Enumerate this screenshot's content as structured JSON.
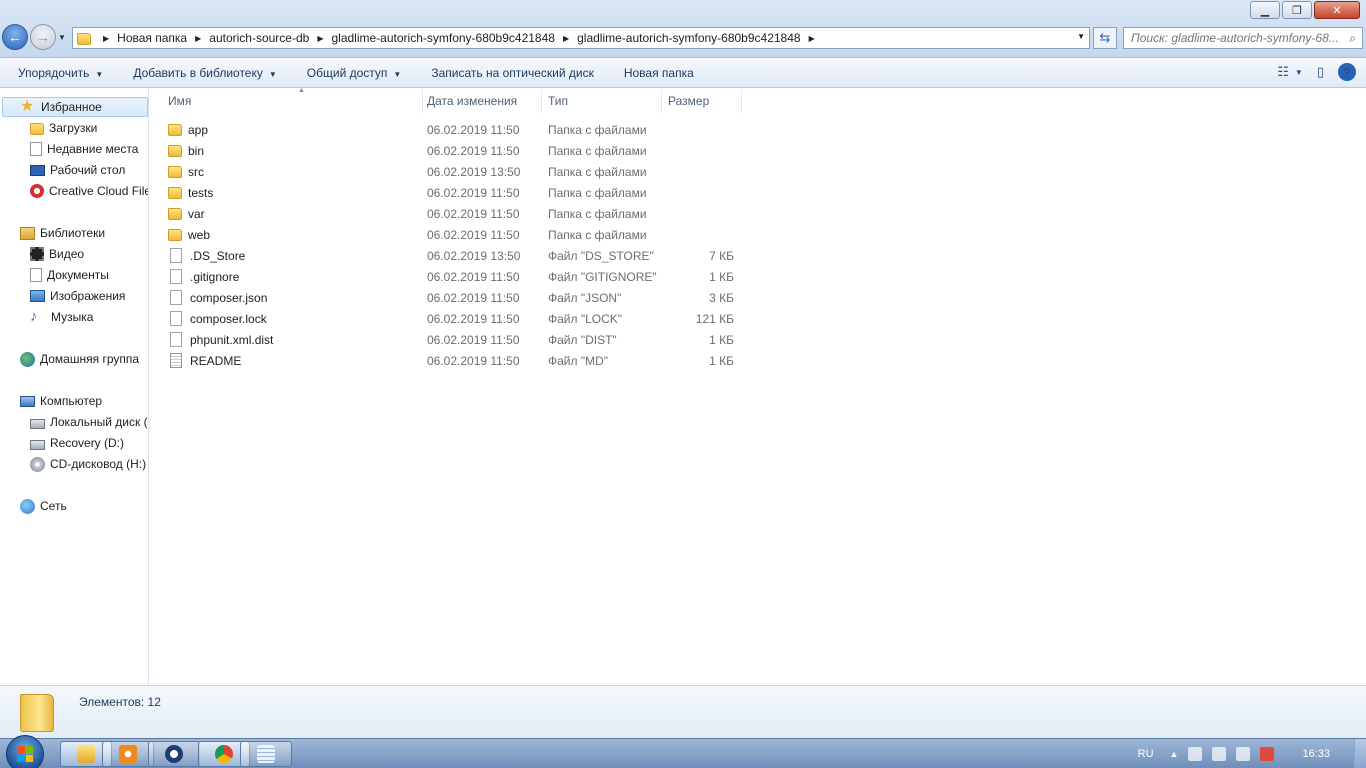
{
  "window": {
    "controls": {
      "minimize": "▁",
      "maximize": "❐",
      "close": "✕"
    }
  },
  "address_bar": {
    "crumbs": [
      "Новая папка",
      "autorich-source-db",
      "gladlime-autorich-symfony-680b9c421848",
      "gladlime-autorich-symfony-680b9c421848"
    ]
  },
  "search": {
    "placeholder": "Поиск: gladlime-autorich-symfony-68..."
  },
  "toolbar": {
    "organize": "Упорядочить",
    "add_to_library": "Добавить в библиотеку",
    "share": "Общий доступ",
    "burn": "Записать на оптический диск",
    "new_folder": "Новая папка",
    "help": "?"
  },
  "sidebar": {
    "favorites": "Избранное",
    "favorites_items": [
      "Загрузки",
      "Недавние места",
      "Рабочий стол",
      "Creative Cloud Files"
    ],
    "libraries": "Библиотеки",
    "libraries_items": [
      "Видео",
      "Документы",
      "Изображения",
      "Музыка"
    ],
    "homegroup": "Домашняя группа",
    "computer": "Компьютер",
    "computer_items": [
      "Локальный диск (C:)",
      "Recovery (D:)",
      "CD-дисковод (H:)"
    ],
    "network": "Сеть"
  },
  "columns": {
    "name": "Имя",
    "date": "Дата изменения",
    "type": "Тип",
    "size": "Размер"
  },
  "files": [
    {
      "name": "app",
      "date": "06.02.2019 11:50",
      "type": "Папка с файлами",
      "size": "",
      "kind": "folder"
    },
    {
      "name": "bin",
      "date": "06.02.2019 11:50",
      "type": "Папка с файлами",
      "size": "",
      "kind": "folder"
    },
    {
      "name": "src",
      "date": "06.02.2019 13:50",
      "type": "Папка с файлами",
      "size": "",
      "kind": "folder"
    },
    {
      "name": "tests",
      "date": "06.02.2019 11:50",
      "type": "Папка с файлами",
      "size": "",
      "kind": "folder"
    },
    {
      "name": "var",
      "date": "06.02.2019 11:50",
      "type": "Папка с файлами",
      "size": "",
      "kind": "folder"
    },
    {
      "name": "web",
      "date": "06.02.2019 11:50",
      "type": "Папка с файлами",
      "size": "",
      "kind": "folder"
    },
    {
      "name": ".DS_Store",
      "date": "06.02.2019 13:50",
      "type": "Файл \"DS_STORE\"",
      "size": "7 КБ",
      "kind": "file"
    },
    {
      "name": ".gitignore",
      "date": "06.02.2019 11:50",
      "type": "Файл \"GITIGNORE\"",
      "size": "1 КБ",
      "kind": "file"
    },
    {
      "name": "composer.json",
      "date": "06.02.2019 11:50",
      "type": "Файл \"JSON\"",
      "size": "3 КБ",
      "kind": "file"
    },
    {
      "name": "composer.lock",
      "date": "06.02.2019 11:50",
      "type": "Файл \"LOCK\"",
      "size": "121 КБ",
      "kind": "file"
    },
    {
      "name": "phpunit.xml.dist",
      "date": "06.02.2019 11:50",
      "type": "Файл \"DIST\"",
      "size": "1 КБ",
      "kind": "file"
    },
    {
      "name": "README",
      "date": "06.02.2019 11:50",
      "type": "Файл \"MD\"",
      "size": "1 КБ",
      "kind": "text"
    }
  ],
  "details": {
    "items_count": "Элементов: 12"
  },
  "taskbar": {
    "language": "RU",
    "clock": "16:33"
  },
  "colors": {
    "accent": "#2463b8",
    "taskbar": "#6f8fbb",
    "folder": "#efbb34"
  }
}
